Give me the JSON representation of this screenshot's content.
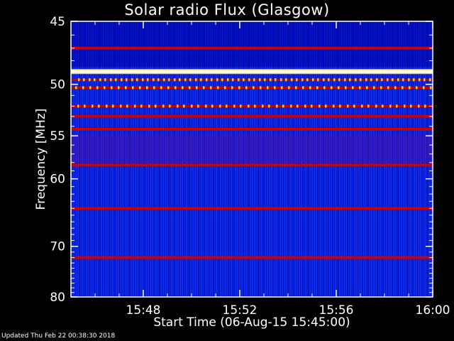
{
  "chart_data": {
    "type": "heatmap",
    "title": "Solar radio Flux (Glasgow)",
    "xlabel": "Start Time (06-Aug-15 15:45:00)",
    "ylabel": "Frequency [MHz]",
    "x_ticks": [
      "15:48",
      "15:52",
      "15:56",
      "16:00"
    ],
    "x_range": [
      "15:45",
      "16:00"
    ],
    "y_ticks": [
      45,
      50,
      55,
      60,
      70,
      80
    ],
    "ylim": [
      80,
      45
    ],
    "y_scale": "reciprocal",
    "colors": {
      "background": "#0a1ad6",
      "low": "#0000b4",
      "mid": "#c80000",
      "high": "#ffd21e",
      "peak": "#ffffff"
    },
    "bands": [
      {
        "freq": 47.0,
        "intensity": "mid"
      },
      {
        "freq": 48.9,
        "intensity": "peak"
      },
      {
        "freq": 49.6,
        "intensity": "high"
      },
      {
        "freq": 50.3,
        "intensity": "high"
      },
      {
        "freq": 52.0,
        "intensity": "high"
      },
      {
        "freq": 53.0,
        "intensity": "mid"
      },
      {
        "freq": 54.3,
        "intensity": "mid"
      },
      {
        "freq": 58.3,
        "intensity": "mid"
      },
      {
        "freq": 64.0,
        "intensity": "mid"
      },
      {
        "freq": 72.0,
        "intensity": "mid"
      }
    ]
  },
  "footer": "Updated Thu Feb 22 00:38:30 2018"
}
